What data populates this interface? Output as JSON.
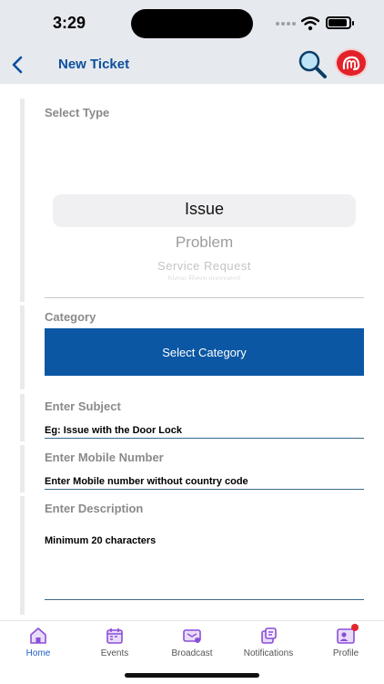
{
  "status": {
    "time": "3:29"
  },
  "header": {
    "title": "New Ticket"
  },
  "form": {
    "select_type": {
      "label": "Select Type",
      "options": [
        "Issue",
        "Problem",
        "Service Request",
        "New Requirement"
      ],
      "selected": "Issue"
    },
    "category": {
      "label": "Category",
      "button_label": "Select Category"
    },
    "subject": {
      "label": "Enter Subject",
      "placeholder": "Eg: Issue with the Door Lock"
    },
    "mobile": {
      "label": "Enter Mobile Number",
      "placeholder": "Enter Mobile number without country code"
    },
    "description": {
      "label": "Enter Description",
      "placeholder": "Minimum 20 characters"
    }
  },
  "tabs": [
    {
      "label": "Home",
      "icon": "home-icon",
      "active": true
    },
    {
      "label": "Events",
      "icon": "calendar-icon",
      "active": false
    },
    {
      "label": "Broadcast",
      "icon": "broadcast-icon",
      "active": false
    },
    {
      "label": "Notifications",
      "icon": "notifications-icon",
      "active": false
    },
    {
      "label": "Profile",
      "icon": "profile-icon",
      "active": false,
      "badge": true
    }
  ],
  "colors": {
    "brand_blue": "#0b57a4",
    "title_blue": "#0c4f9c",
    "avatar_red": "#e32129",
    "tab_icon_purple": "#8a4fd6"
  }
}
